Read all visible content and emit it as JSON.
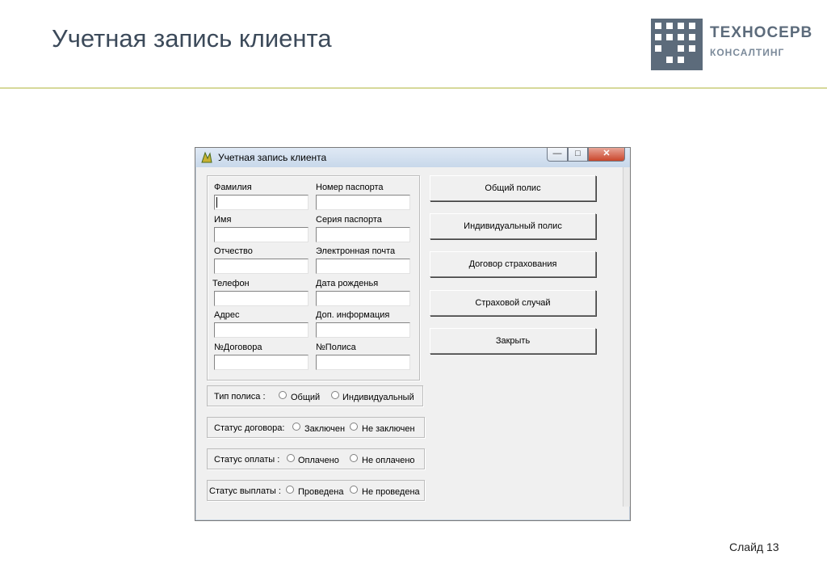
{
  "slide": {
    "title": "Учетная запись клиента",
    "slide_number": "Слайд 13",
    "logo_name": "ТЕХНОСЕРВ",
    "logo_sub": "КОНСАЛТИНГ"
  },
  "window": {
    "title": "Учетная запись клиента",
    "controls": {
      "minimize": "—",
      "maximize": "□",
      "close": "✕"
    }
  },
  "fields": {
    "surname": {
      "label": "Фамилия",
      "value": ""
    },
    "passport_number": {
      "label": "Номер паспорта",
      "value": ""
    },
    "name": {
      "label": "Имя",
      "value": ""
    },
    "passport_series": {
      "label": "Серия паспорта",
      "value": ""
    },
    "patronymic": {
      "label": "Отчество",
      "value": ""
    },
    "email": {
      "label": "Электронная почта",
      "value": ""
    },
    "phone": {
      "label": "Телефон",
      "value": ""
    },
    "birth_date": {
      "label": "Дата рожденья",
      "value": ""
    },
    "address": {
      "label": "Адрес",
      "value": ""
    },
    "extra_info": {
      "label": "Доп. информация",
      "value": ""
    },
    "contract_no": {
      "label": "№Договора",
      "value": ""
    },
    "policy_no": {
      "label": "№Полиса",
      "value": ""
    }
  },
  "radio_groups": {
    "policy_type": {
      "label": "Тип полиса :",
      "options": [
        "Общий",
        "Индивидуальный"
      ]
    },
    "contract_status": {
      "label": "Статус договора:",
      "options": [
        "Заключен",
        "Не заключен"
      ]
    },
    "payment_status": {
      "label": "Статус оплаты :",
      "options": [
        "Оплачено",
        "Не оплачено"
      ]
    },
    "payout_status": {
      "label": "Статус выплаты :",
      "options": [
        "Проведена",
        "Не проведена"
      ]
    }
  },
  "buttons": {
    "general_policy": "Общий полис",
    "individual_policy": "Индивидуальный полис",
    "insurance_contract": "Договор страхования",
    "insured_event": "Страховой случай",
    "close": "Закрыть"
  },
  "colors": {
    "title_text": "#3c4a5a",
    "rule": "#d6d99a",
    "logo": "#5c6b7b",
    "window_bg": "#f0f0f0",
    "close_button": "#c9462b"
  }
}
